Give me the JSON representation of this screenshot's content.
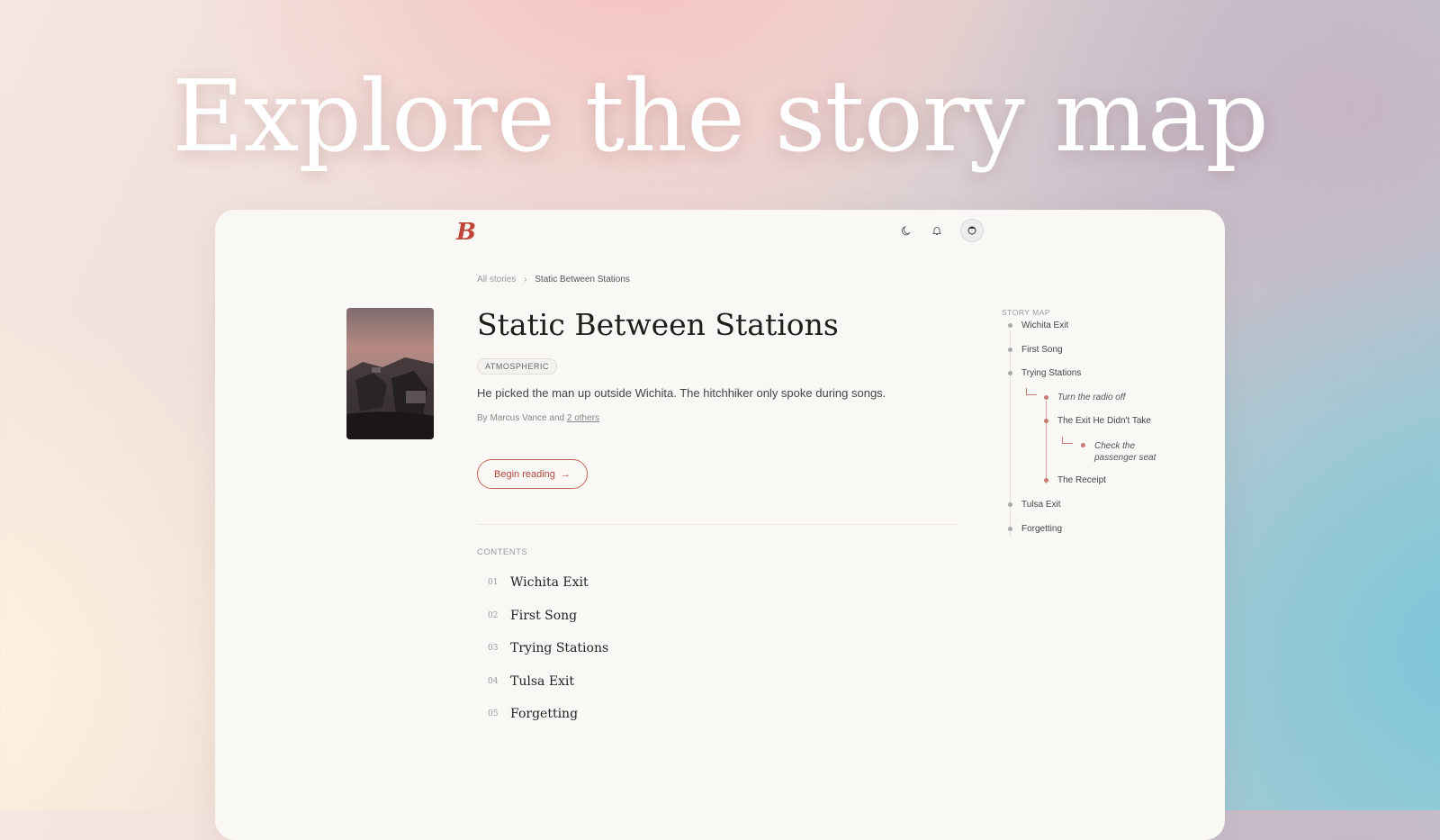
{
  "hero": {
    "title": "Explore the story map"
  },
  "header": {
    "logo": "B",
    "icons": [
      "moon-icon",
      "bell-icon",
      "avatar"
    ]
  },
  "breadcrumb": {
    "root": "All stories",
    "separator": "›",
    "current": "Static Between Stations"
  },
  "story": {
    "title": "Static Between Stations",
    "tag": "ATMOSPHERIC",
    "description": "He picked the man up outside Wichita. The hitchhiker only spoke during songs.",
    "byline_prefix": "By Marcus Vance and",
    "byline_link": "2 others",
    "cta_label": "Begin reading",
    "cta_arrow": "→"
  },
  "contents": {
    "label": "CONTENTS",
    "items": [
      {
        "num": "01",
        "name": "Wichita Exit"
      },
      {
        "num": "02",
        "name": "First Song"
      },
      {
        "num": "03",
        "name": "Trying Stations"
      },
      {
        "num": "04",
        "name": "Tulsa Exit"
      },
      {
        "num": "05",
        "name": "Forgetting"
      }
    ]
  },
  "story_map": {
    "label": "STORY MAP",
    "nodes": [
      "Wichita Exit",
      "First Song",
      "Trying Stations",
      "Turn the radio off",
      "The Exit He Didn't Take",
      "Check the passenger seat",
      "The Receipt",
      "Tulsa Exit",
      "Forgetting"
    ]
  },
  "colors": {
    "accent": "#c0453a",
    "card": "#faf8f5",
    "branch": "#c77b70"
  }
}
